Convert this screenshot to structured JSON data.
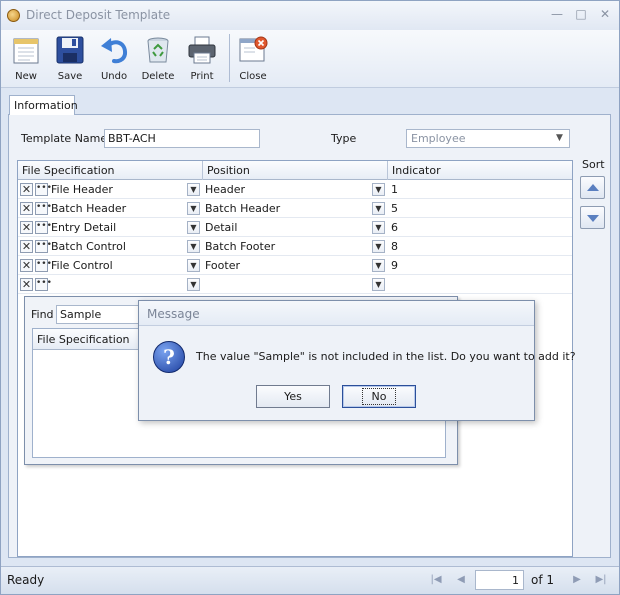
{
  "window": {
    "title": "Direct Deposit Template"
  },
  "toolbar": {
    "buttons": [
      {
        "label": "New",
        "icon": "new-document-icon"
      },
      {
        "label": "Save",
        "icon": "floppy-disk-icon"
      },
      {
        "label": "Undo",
        "icon": "undo-arrow-icon"
      },
      {
        "label": "Delete",
        "icon": "recycle-bin-icon"
      },
      {
        "label": "Print",
        "icon": "printer-icon"
      },
      {
        "label": "Close",
        "icon": "close-window-icon"
      }
    ]
  },
  "tabs": [
    {
      "label": "Information",
      "active": true
    }
  ],
  "form": {
    "template_name_label": "Template Name",
    "template_name_value": "BBT-ACH",
    "type_label": "Type",
    "type_value": "Employee"
  },
  "grid": {
    "columns": [
      "File Specification",
      "Position",
      "Indicator"
    ],
    "rows": [
      {
        "spec": "File Header",
        "position": "Header",
        "indicator": "1"
      },
      {
        "spec": "Batch Header",
        "position": "Batch Header",
        "indicator": "5"
      },
      {
        "spec": "Entry Detail",
        "position": "Detail",
        "indicator": "6"
      },
      {
        "spec": "Batch Control",
        "position": "Batch Footer",
        "indicator": "8"
      },
      {
        "spec": "File Control",
        "position": "Footer",
        "indicator": "9"
      },
      {
        "spec": "",
        "position": "",
        "indicator": ""
      }
    ]
  },
  "popup": {
    "find_label": "Find",
    "find_value": "Sample",
    "list_header": "File Specification"
  },
  "message": {
    "title": "Message",
    "text": "The value \"Sample\" is not included in the list. Do you want to add it?",
    "yes_label": "Yes",
    "no_label": "No",
    "icon": "question-icon"
  },
  "sort": {
    "label": "Sort"
  },
  "status": {
    "text": "Ready",
    "page": "1",
    "of_label": "of 1"
  },
  "colors": {
    "accent": "#1d3f9e",
    "chrome": "#dde6f3"
  }
}
